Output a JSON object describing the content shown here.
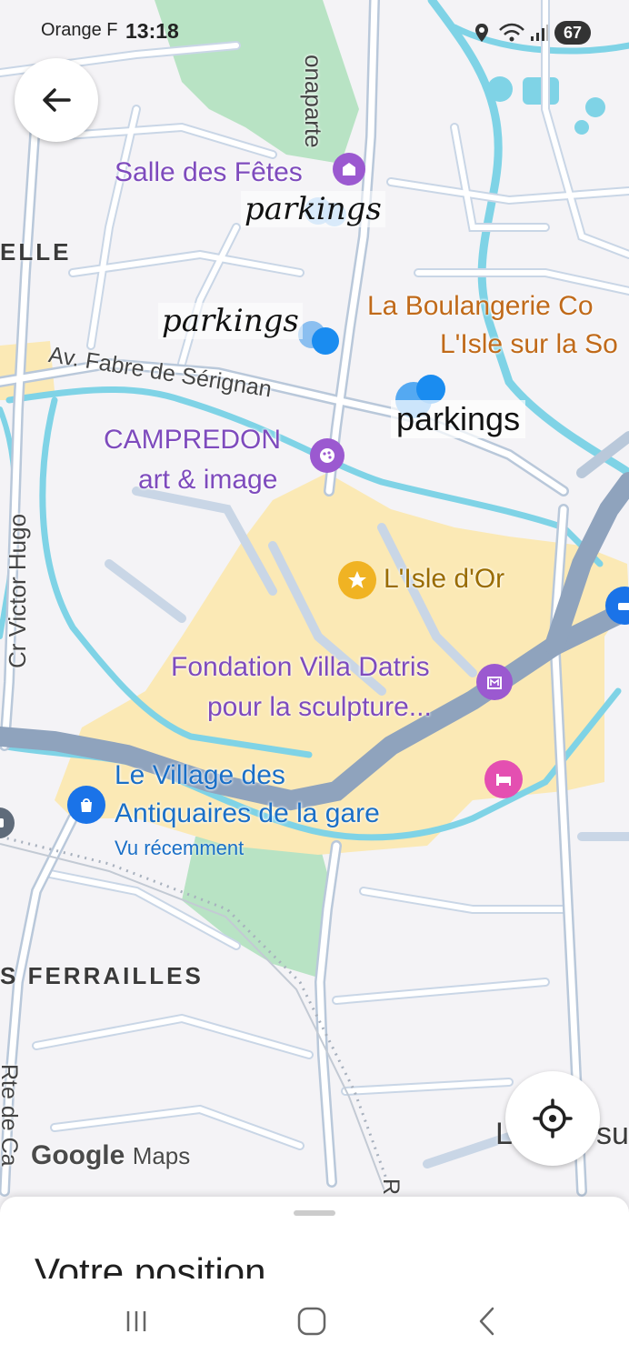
{
  "status_bar": {
    "carrier": "Orange F",
    "time": "13:18",
    "battery": "67",
    "icons": [
      "location-icon",
      "wifi-icon",
      "signal-icon",
      "battery-icon"
    ]
  },
  "map": {
    "attribution_logo": "Google",
    "attribution_product": "Maps",
    "pois": {
      "salle": "Salle des Fêtes",
      "boulangerie_line1": "La Boulangerie Co",
      "boulangerie_line2": "L'Isle sur la So",
      "campredon_line1": "CAMPREDON",
      "campredon_line2": "art & image",
      "isle_dor": "L'Isle d'Or",
      "villa_line1": "Fondation Villa Datris",
      "villa_line2": "pour la sculpture...",
      "village_line1": "Le Village des",
      "village_line2": "Antiquaires de la gare",
      "village_note": "Vu récemment"
    },
    "roads": {
      "bonaparte": "onaparte",
      "fabre": "Av. Fabre de Sérignan",
      "victor_hugo": "Cr Victor Hugo",
      "rte_cav": "Rte de Ca",
      "r_bottom": "R"
    },
    "districts": {
      "elle": "ELLE",
      "ferrailles": "S FERRAILLES",
      "l_su_left": "L",
      "l_su_right": "su"
    },
    "annotations": {
      "parkings_1": "parkings",
      "parkings_2": "parkings",
      "parkings_3": "parkings"
    },
    "colors": {
      "water": "#7fd3e6",
      "park": "#b8e3c4",
      "town": "#fbe9b5",
      "major_road": "#8fa3bd",
      "minor_road": "#ffffff",
      "purple": "#7e4bbd",
      "gold": "#f0b323",
      "blue_pin": "#1a73e8",
      "pink": "#e44fb1"
    }
  },
  "controls": {
    "back": "back-arrow-icon",
    "locate": "my-location-icon"
  },
  "sheet": {
    "title": "Votre position"
  },
  "nav": {
    "recents": "recents-icon",
    "home": "home-icon",
    "back": "back-icon"
  }
}
